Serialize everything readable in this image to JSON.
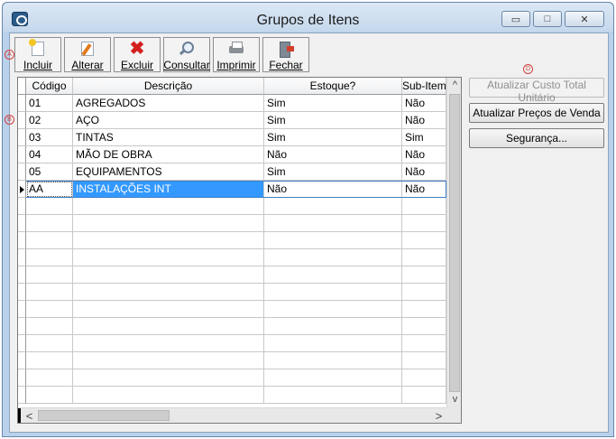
{
  "window": {
    "title": "Grupos de Itens",
    "minimize_glyph": "▭",
    "maximize_glyph": "□",
    "close_glyph": "✕"
  },
  "toolbar": {
    "buttons": [
      {
        "label": "Incluir",
        "icon": "new-document-icon"
      },
      {
        "label": "Alterar",
        "icon": "edit-icon"
      },
      {
        "label": "Excluir",
        "icon": "delete-icon"
      },
      {
        "label": "Consultar",
        "icon": "search-icon"
      },
      {
        "label": "Imprimir",
        "icon": "printer-icon"
      },
      {
        "label": "Fechar",
        "icon": "exit-icon"
      }
    ]
  },
  "markers": {
    "a": "A",
    "b": "B",
    "d": "D"
  },
  "grid": {
    "columns": [
      "Código",
      "Descrição",
      "Estoque?",
      "Sub-Item?"
    ],
    "rows": [
      {
        "codigo": "01",
        "descricao": "AGREGADOS",
        "estoque": "Sim",
        "subitem": "Não"
      },
      {
        "codigo": "02",
        "descricao": "AÇO",
        "estoque": "Sim",
        "subitem": "Não"
      },
      {
        "codigo": "03",
        "descricao": "TINTAS",
        "estoque": "Sim",
        "subitem": "Sim"
      },
      {
        "codigo": "04",
        "descricao": "MÃO DE OBRA",
        "estoque": "Não",
        "subitem": "Não"
      },
      {
        "codigo": "05",
        "descricao": "EQUIPAMENTOS",
        "estoque": "Sim",
        "subitem": "Não"
      },
      {
        "codigo": "AA",
        "descricao": "INSTALAÇÕES INT",
        "estoque": "Não",
        "subitem": "Não"
      }
    ],
    "selected_row": 5,
    "scroll_up_glyph": "^",
    "scroll_down_glyph": "v",
    "scroll_left_glyph": "<",
    "scroll_right_glyph": ">"
  },
  "side_buttons": {
    "custo": "Atualizar Custo Total Unitário",
    "precos": "Atualizar Preços de Venda",
    "seguranca": "Segurança..."
  }
}
